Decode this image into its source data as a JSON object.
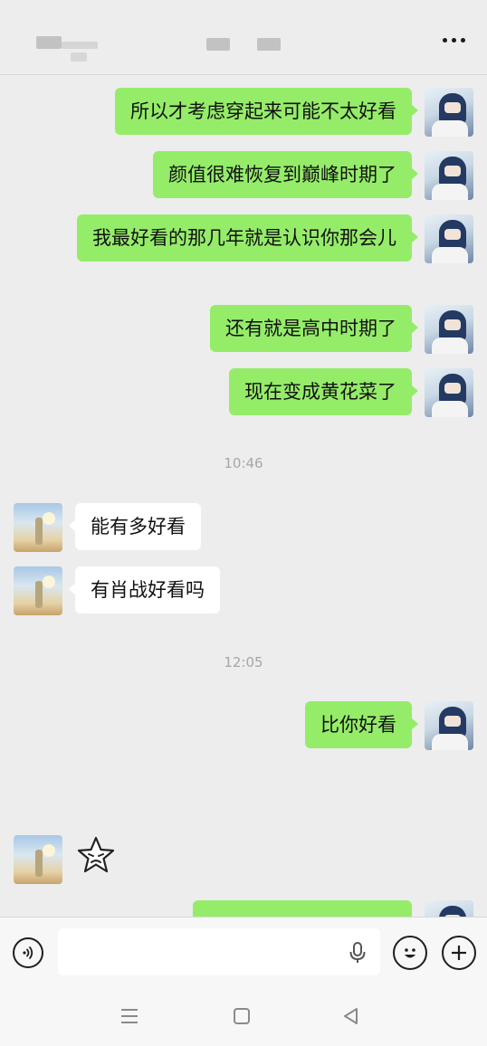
{
  "header": {
    "more_icon": "more-dots-icon"
  },
  "messages_right_1": [
    {
      "text": "所以才考虑穿起来可能不太好看"
    },
    {
      "text": "颜值很难恢复到巅峰时期了"
    },
    {
      "text": "我最好看的那几年就是认识你那会儿"
    },
    {
      "text": "还有就是高中时期了"
    },
    {
      "text": "现在变成黄花菜了"
    }
  ],
  "timestamp_1": "10:46",
  "messages_left": [
    {
      "text": "能有多好看"
    },
    {
      "text": "有肖战好看吗"
    }
  ],
  "timestamp_2": "12:05",
  "messages_right_2": [
    {
      "text": "比你好看"
    }
  ],
  "sticker": {
    "icon": "pouting-star-sticker-icon"
  },
  "input": {
    "value": "",
    "voice_icon": "voice-mode-icon",
    "mic_icon": "microphone-icon",
    "emoji_icon": "emoji-icon",
    "plus_icon": "plus-icon"
  },
  "nav": {
    "menu_icon": "menu-icon",
    "home_icon": "home-icon",
    "back_icon": "back-icon"
  },
  "colors": {
    "my_bubble": "#95ec69",
    "their_bubble": "#ffffff",
    "background": "#ededed"
  }
}
